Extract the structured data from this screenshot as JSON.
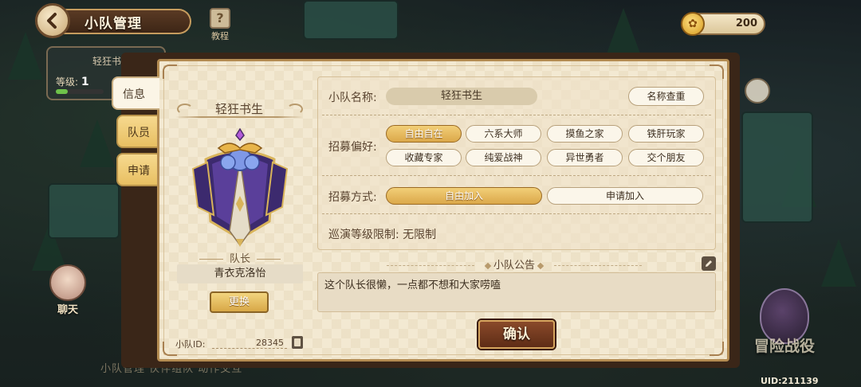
{
  "topbar": {
    "title": "小队管理",
    "tutorial_label": "教程",
    "tutorial_glyph": "?",
    "currency_value": "200"
  },
  "background": {
    "squad_name": "轻狂书",
    "level_label": "等级:",
    "level_value": "1",
    "level_progress": 0.25,
    "chat_label": "聊天",
    "bottom_nav": "小队管理  伙伴组队  动作交互",
    "adventure_label": "冒险战役",
    "uid": "UID:211139"
  },
  "tabs": [
    {
      "label": "信息",
      "active": true
    },
    {
      "label": "队员",
      "active": false
    },
    {
      "label": "申请",
      "active": false
    }
  ],
  "squad": {
    "name": "轻狂书生",
    "leader_label": "队长",
    "leader_name": "青衣克洛怡",
    "swap_label": "更换",
    "id_label": "小队ID:",
    "id_value": "28345"
  },
  "settings": {
    "name_label": "小队名称:",
    "name_value": "轻狂书生",
    "check_name_label": "名称查重",
    "pref_label": "招募偏好:",
    "preferences": [
      {
        "label": "自由自在",
        "selected": true
      },
      {
        "label": "六系大师",
        "selected": false
      },
      {
        "label": "摸鱼之家",
        "selected": false
      },
      {
        "label": "铁肝玩家",
        "selected": false
      },
      {
        "label": "收藏专家",
        "selected": false
      },
      {
        "label": "纯爱战神",
        "selected": false
      },
      {
        "label": "异世勇者",
        "selected": false
      },
      {
        "label": "交个朋友",
        "selected": false
      }
    ],
    "method_label": "招募方式:",
    "methods": [
      {
        "label": "自由加入",
        "selected": true
      },
      {
        "label": "申请加入",
        "selected": false
      }
    ],
    "level_limit_label": "巡演等级限制:",
    "level_limit_value": "无限制"
  },
  "notice": {
    "title": "小队公告",
    "text": "这个队长很懒，一点都不想和大家唠嗑"
  },
  "confirm_label": "确认",
  "colors": {
    "accent_gold": "#dba84a",
    "panel_bg": "#f3e9d2",
    "confirm_bg": "#6e3820",
    "emblem_purple": "#3c2a6e"
  }
}
